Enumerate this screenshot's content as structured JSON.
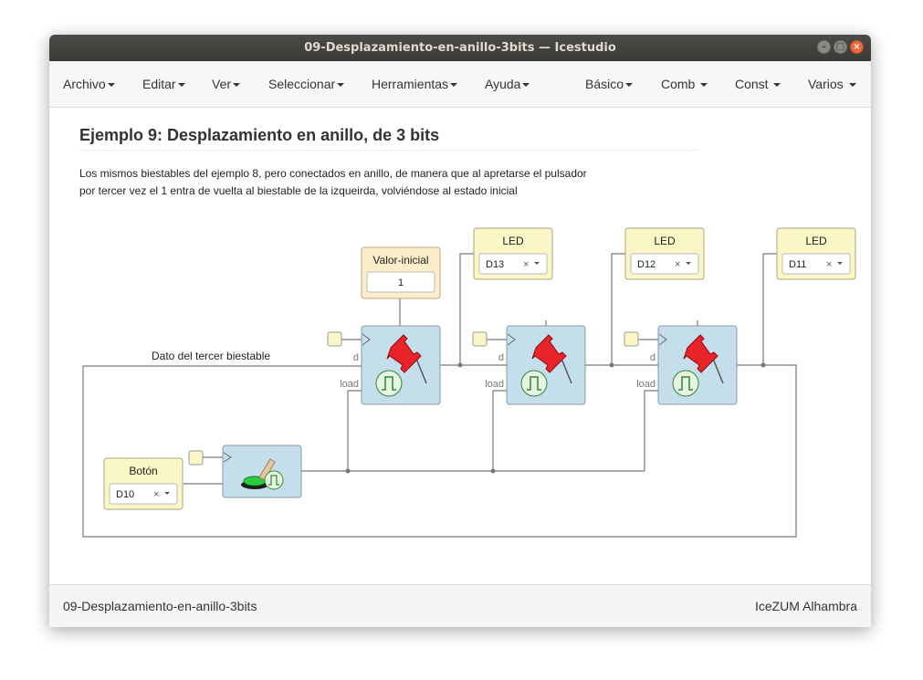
{
  "window": {
    "title": "09-Desplazamiento-en-anillo-3bits — Icestudio"
  },
  "menus": {
    "left": [
      "Archivo",
      "Editar",
      "Ver",
      "Seleccionar",
      "Herramientas",
      "Ayuda"
    ],
    "right": [
      "Básico",
      "Comb",
      "Const",
      "Varios"
    ]
  },
  "page": {
    "title": "Ejemplo 9: Desplazamiento en anillo, de 3 bits",
    "description_line1": "Los mismos biestables del ejemplo 8, pero conectados en anillo, de manera que al apretarse el pulsador",
    "description_line2": "por tercer vez el 1 entra de vuelta al biestable de la izqueirda, volviéndose al estado inicial"
  },
  "circuit": {
    "wire_label": "Dato del tercer biestable",
    "valor_inicial": {
      "label": "Valor-inicial",
      "value": "1"
    },
    "button_block": {
      "label": "Botón",
      "pin": "D10"
    },
    "leds": [
      {
        "label": "LED",
        "pin": "D13"
      },
      {
        "label": "LED",
        "pin": "D12"
      },
      {
        "label": "LED",
        "pin": "D11"
      }
    ],
    "flipflop_ports": {
      "data": "d",
      "load": "load"
    },
    "clear_symbol": "×"
  },
  "status": {
    "file": "09-Desplazamiento-en-anillo-3bits",
    "board": "IceZUM Alhambra"
  },
  "colors": {
    "block_blue": "#c4dfeb",
    "block_yellow": "#fbf6c6",
    "constant_block": "#fdeecb",
    "wire": "#777777",
    "pin_red": "#e8232a"
  },
  "icons": {
    "flipflop": "red-pushpin-icon",
    "button": "green-pushbutton-icon",
    "window_close": "close-icon"
  }
}
